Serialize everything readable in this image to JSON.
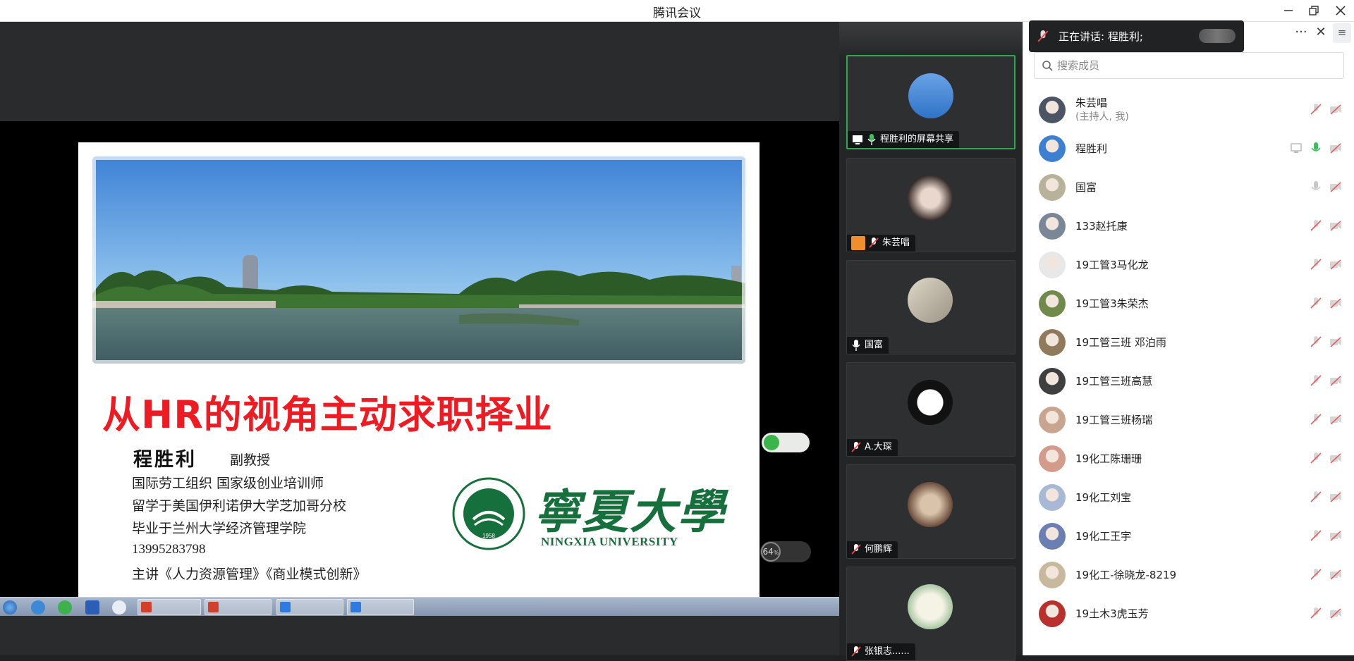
{
  "window": {
    "title": "腾讯会议"
  },
  "slide": {
    "title": "从HR的视角主动求职择业",
    "presenter_name": "程胜利",
    "presenter_title": "副教授",
    "lines": [
      "国际劳工组织 国家级创业培训师",
      "留学于美国伊利诺伊大学芝加哥分校",
      "毕业于兰州大学经济管理学院",
      "13995283798",
      "主讲《人力资源管理》《商业模式创新》"
    ],
    "university_cn": "寧夏大學",
    "university_en": "NINGXIA UNIVERSITY",
    "logo_year": "1958"
  },
  "remote_overlay": {
    "network_value": "64",
    "network_unit": "%"
  },
  "video_tiles": [
    {
      "label": "程胜利的屏幕共享",
      "active": true,
      "avatar_color": "#2e73c6"
    },
    {
      "label": "朱芸唱",
      "active": false,
      "avatar_color": "#6a5a55"
    },
    {
      "label": "国富",
      "active": false,
      "avatar_color": "#c9c4b7"
    },
    {
      "label": "A.大琛",
      "active": false,
      "avatar_color": "#f1f1f1"
    },
    {
      "label": "何鹏辉",
      "active": false,
      "avatar_color": "#b08870"
    },
    {
      "label": "张银志......",
      "active": false,
      "avatar_color": "#dfe8dd"
    }
  ],
  "panel": {
    "speaking_prefix": "正在讲话: ",
    "speaking_name": "程胜利;",
    "more_label": "···",
    "close_label": "✕",
    "list_label": "≡",
    "search_placeholder": "搜索成员"
  },
  "members": [
    {
      "name": "朱芸唱",
      "sub": "(主持人, 我)",
      "mic": "muted",
      "av": "#4b5563"
    },
    {
      "name": "程胜利",
      "sub": "",
      "mic": "on",
      "av": "#3d7fd0",
      "sharing": true
    },
    {
      "name": "国富",
      "sub": "",
      "mic": "off",
      "av": "#b8b29a"
    },
    {
      "name": "133赵托康",
      "sub": "",
      "mic": "muted",
      "av": "#7a8797"
    },
    {
      "name": "19工管3马化龙",
      "sub": "",
      "mic": "muted",
      "av": "#e8e8e8"
    },
    {
      "name": "19工管3朱荣杰",
      "sub": "",
      "mic": "muted",
      "av": "#6f8a4a"
    },
    {
      "name": "19工管三班 邓泊雨",
      "sub": "",
      "mic": "muted",
      "av": "#8f7a5c"
    },
    {
      "name": "19工管三班高慧",
      "sub": "",
      "mic": "muted",
      "av": "#3f3f3f"
    },
    {
      "name": "19工管三班杨瑞",
      "sub": "",
      "mic": "muted",
      "av": "#c9a58f"
    },
    {
      "name": "19化工陈珊珊",
      "sub": "",
      "mic": "muted",
      "av": "#d39b8a"
    },
    {
      "name": "19化工刘宝",
      "sub": "",
      "mic": "muted",
      "av": "#a8b9d6"
    },
    {
      "name": "19化工王宇",
      "sub": "",
      "mic": "muted",
      "av": "#6c7fb3"
    },
    {
      "name": "19化工-徐晓龙-8219",
      "sub": "",
      "mic": "muted",
      "av": "#c8b89e"
    },
    {
      "name": "19土木3虎玉芳",
      "sub": "",
      "mic": "muted",
      "av": "#b8312f"
    }
  ]
}
